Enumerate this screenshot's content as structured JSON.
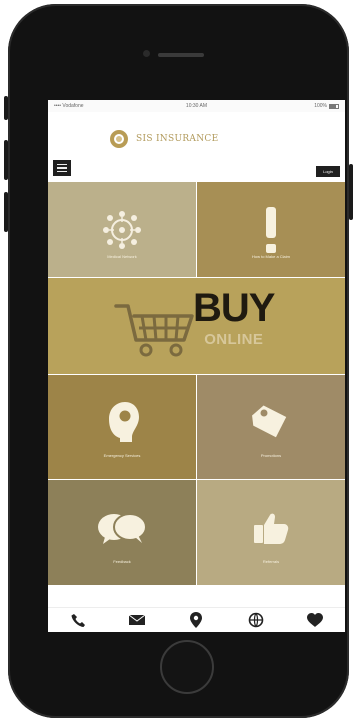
{
  "status_bar": {
    "left": "•••• Vodafone",
    "center": "10:30 AM",
    "right": "100%"
  },
  "header": {
    "logo_text": "SIS INSURANCE",
    "login_label": "Login"
  },
  "tiles": [
    {
      "label": "Medical Network"
    },
    {
      "label": "How to Make a Claim"
    },
    {
      "title": "BUY",
      "subtitle": "ONLINE"
    },
    {
      "label": "Emergency Services"
    },
    {
      "label": "Promotions"
    },
    {
      "label": "Feedback"
    },
    {
      "label": "Referrals"
    }
  ],
  "bottom_nav": [
    {
      "icon": "phone-icon"
    },
    {
      "icon": "mail-icon"
    },
    {
      "icon": "location-icon"
    },
    {
      "icon": "globe-icon"
    },
    {
      "icon": "heart-icon"
    }
  ],
  "colors": {
    "gold_light": "#bbb08b",
    "gold_medium": "#a78f55",
    "gold_buy": "#b8a25b",
    "gold_dark": "#9d8448",
    "gold_muted": "#9f8b67",
    "gold_olive": "#8d8059",
    "gold_pale": "#b8aa82"
  }
}
